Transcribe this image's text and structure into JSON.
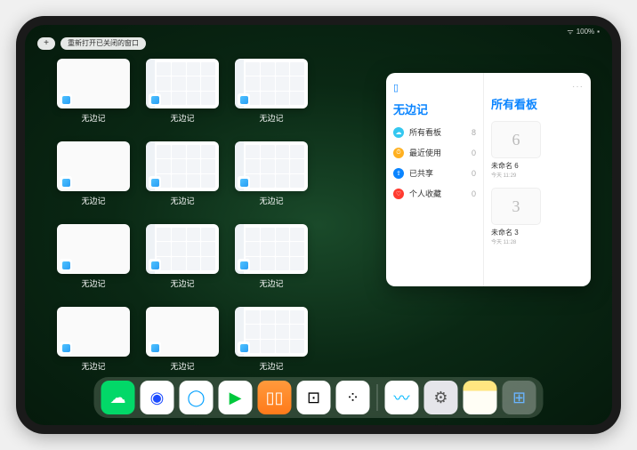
{
  "statusbar": {
    "wifi": "ᯤ",
    "battery": "100%",
    "charge": "▪"
  },
  "topbar": {
    "add": "+",
    "reopen": "重新打开已关闭的窗口"
  },
  "app_label": "无边记",
  "windows": [
    {
      "style": "blank"
    },
    {
      "style": "grid"
    },
    {
      "style": "grid"
    },
    {
      "style": "blank"
    },
    {
      "style": "grid"
    },
    {
      "style": "grid"
    },
    {
      "style": "blank"
    },
    {
      "style": "grid"
    },
    {
      "style": "grid"
    },
    {
      "style": "blank"
    },
    {
      "style": "blank"
    },
    {
      "style": "grid"
    }
  ],
  "panel": {
    "title": "无边记",
    "more": "···",
    "items": [
      {
        "icon_bg": "#34c7f0",
        "glyph": "☁",
        "label": "所有看板",
        "count": "8"
      },
      {
        "icon_bg": "#ffb020",
        "glyph": "⏱",
        "label": "最近使用",
        "count": "0"
      },
      {
        "icon_bg": "#0a84ff",
        "glyph": "⇪",
        "label": "已共享",
        "count": "0"
      },
      {
        "icon_bg": "#ff3b30",
        "glyph": "♡",
        "label": "个人收藏",
        "count": "0"
      }
    ],
    "right_title": "所有看板",
    "boards": [
      {
        "sketch": "6",
        "name": "未命名 6",
        "time": "今天 11:29"
      },
      {
        "sketch": "3",
        "name": "未命名 3",
        "time": "今天 11:28"
      }
    ]
  },
  "dock": [
    {
      "name": "wechat",
      "bg": "#02d868",
      "glyph": "☁",
      "fg": "#fff"
    },
    {
      "name": "tencent-video",
      "bg": "#ffffff",
      "glyph": "◉",
      "fg": "#1c4bff"
    },
    {
      "name": "qq-browser",
      "bg": "#ffffff",
      "glyph": "◯",
      "fg": "#00a0ff"
    },
    {
      "name": "iqiyi",
      "bg": "#ffffff",
      "glyph": "▶",
      "fg": "#00c83c"
    },
    {
      "name": "books",
      "bg": "linear-gradient(#ff9a3c,#ff7a1a)",
      "glyph": "▯▯",
      "fg": "#fff"
    },
    {
      "name": "dice",
      "bg": "#ffffff",
      "glyph": "⊡",
      "fg": "#000"
    },
    {
      "name": "dots",
      "bg": "#ffffff",
      "glyph": "⁘",
      "fg": "#000"
    },
    {
      "name": "sep"
    },
    {
      "name": "freeform",
      "bg": "#ffffff",
      "glyph": "〰",
      "fg": "#00b8ff"
    },
    {
      "name": "settings",
      "bg": "#e5e5ea",
      "glyph": "⚙",
      "fg": "#555"
    },
    {
      "name": "notes",
      "bg": "linear-gradient(#ffe680 0 30%,#fffef5 30%)",
      "glyph": "",
      "fg": "#000"
    },
    {
      "name": "recent-group",
      "bg": "rgba(255,255,255,0.25)",
      "glyph": "⊞",
      "fg": "#6ab4ff"
    }
  ]
}
